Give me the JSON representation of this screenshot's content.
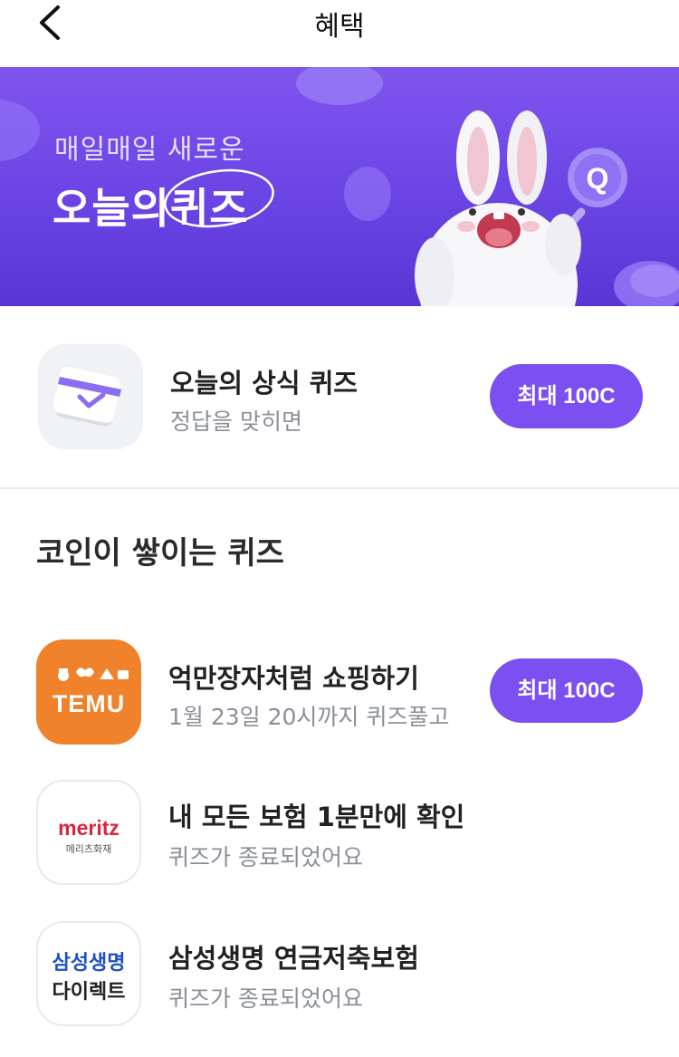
{
  "header": {
    "title": "혜택",
    "back_icon": "chevron-left-icon"
  },
  "banner": {
    "subtitle": "매일매일 새로운",
    "title_plain": "오늘의",
    "title_highlight": "퀴즈",
    "badge_letter": "Q",
    "colors": {
      "top": "#7f55ee",
      "bottom": "#5a35d4"
    }
  },
  "today_quiz": {
    "icon": "calendar-check-icon",
    "title": "오늘의 상식 퀴즈",
    "subtitle": "정답을 맞히면",
    "reward": "최대 100C"
  },
  "section": {
    "title": "코인이 쌓이는 퀴즈"
  },
  "quizzes": [
    {
      "logo_text": "TEMU",
      "title": "억만장자처럼 쇼핑하기",
      "subtitle": "1월 23일 20시까지 퀴즈풀고",
      "reward": "최대 100C"
    },
    {
      "logo_text": "meritz",
      "logo_sub": "메리츠화재",
      "title": "내 모든 보험 1분만에 확인",
      "subtitle": "퀴즈가 종료되었어요"
    },
    {
      "logo_text": "삼성생명",
      "logo_sub": "다이렉트",
      "title": "삼성생명 연금저축보험",
      "subtitle": "퀴즈가 종료되었어요"
    }
  ],
  "colors": {
    "accent": "#7b4ff0",
    "temu": "#f0822c",
    "meritz": "#d7263d",
    "samsung": "#1e4fc9"
  }
}
